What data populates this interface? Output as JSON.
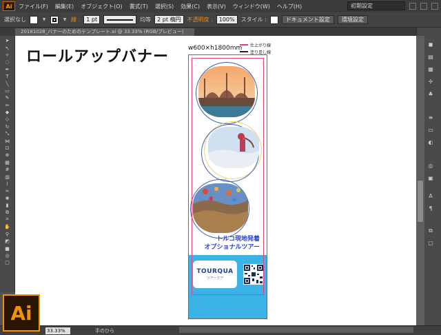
{
  "app": {
    "logo_label": "Ai",
    "menus": [
      "ファイル(F)",
      "編集(E)",
      "オブジェクト(O)",
      "書式(T)",
      "選択(S)",
      "効果(C)",
      "表示(V)",
      "ウィンドウ(W)",
      "ヘルプ(H)"
    ],
    "workspace": "初期設定"
  },
  "controlbar": {
    "selection": "選択なし",
    "stroke_label": "線 :",
    "stroke_value": "1 pt",
    "stroke_style": "均等",
    "brush": "2 pt 楕円",
    "opacity_label": "不透明度 :",
    "opacity_value": "100%",
    "style_label": "スタイル :",
    "doc_setup": "ドキュメント設定",
    "prefs": "環境設定"
  },
  "document": {
    "tab_title": "20181028_バナーのためのテンプレート.ai @ 33.33% (RGB/プレビュー)"
  },
  "canvas": {
    "heading": "ロールアップバナー",
    "dims": "w600×h1800mm",
    "legend": [
      {
        "label": "仕上がり線",
        "color": "#e0437a"
      },
      {
        "label": "塗り足し線",
        "color": "#222222"
      }
    ],
    "banner": {
      "promo_line1": "トルコ現地発着",
      "promo_line2": "オプショナルツアー",
      "logo_text": "TOURQUA",
      "logo_sub": "ツアークア"
    }
  },
  "status": {
    "zoom": "33.33%",
    "tool": "手のひら"
  },
  "badge": {
    "label": "Ai"
  }
}
